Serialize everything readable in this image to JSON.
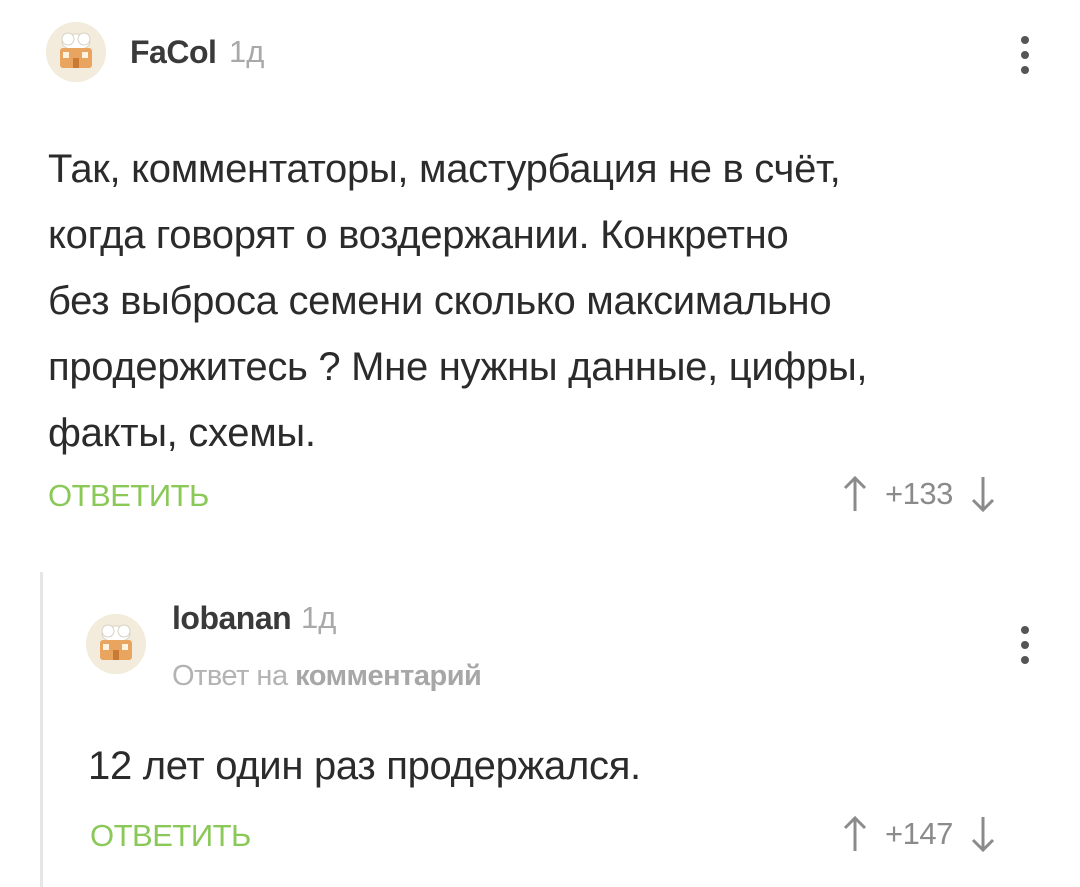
{
  "comments": [
    {
      "author": "FaCol",
      "time": "1д",
      "text_lines": [
        "Так, комментаторы, мастурбация не в счёт,",
        "когда говорят о воздержании. Конкретно",
        "без выброса семени сколько максимально",
        "продержитесь ? Мне нужны данные, цифры,",
        "факты, схемы."
      ],
      "reply_label": "ОТВЕТИТЬ",
      "score": "+133",
      "menu_icon": "more-vertical-icon",
      "avatar_icon": "chef-hat-avatar-icon"
    },
    {
      "author": "lobanan",
      "time": "1д",
      "reply_prefix": "Ответ на",
      "reply_target": "комментарий",
      "text": "12 лет один раз продержался.",
      "reply_label": "ОТВЕТИТЬ",
      "score": "+147",
      "menu_icon": "more-vertical-icon",
      "avatar_icon": "chef-hat-avatar-icon"
    }
  ],
  "colors": {
    "accent_green": "#8ac858",
    "thread_line": "#e6e6e6",
    "muted_text": "#a9a9a9"
  }
}
